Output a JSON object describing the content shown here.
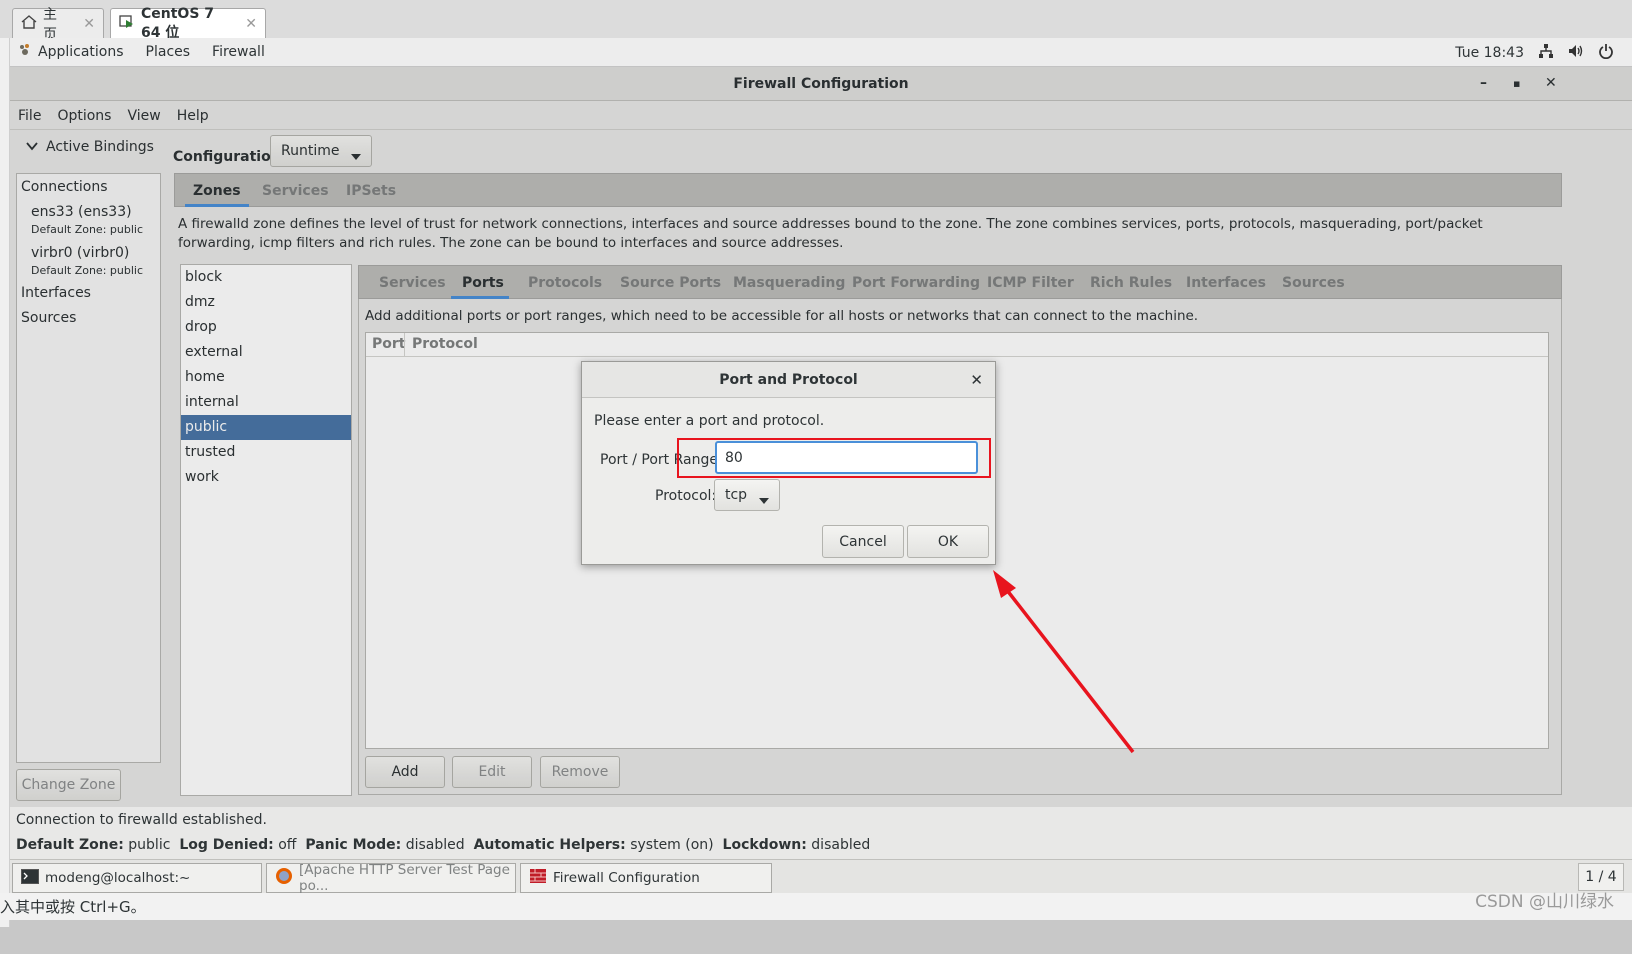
{
  "vm_tabs": [
    {
      "label": "主页",
      "icon": "home-icon"
    },
    {
      "label": "CentOS 7 64 位",
      "icon": "vm-icon"
    }
  ],
  "topbar": {
    "menus": [
      "Applications",
      "Places",
      "Firewall"
    ],
    "clock": "Tue 18:43"
  },
  "window": {
    "title": "Firewall Configuration",
    "menus": [
      "File",
      "Options",
      "View",
      "Help"
    ]
  },
  "left_panel": {
    "toggle_label": "Active Bindings",
    "connections_label": "Connections",
    "connections": [
      {
        "name": "ens33 (ens33)",
        "zone": "Default Zone: public"
      },
      {
        "name": "virbr0 (virbr0)",
        "zone": "Default Zone: public"
      }
    ],
    "interfaces_label": "Interfaces",
    "sources_label": "Sources",
    "change_zone": "Change Zone"
  },
  "config": {
    "label": "Configuration:",
    "value": "Runtime"
  },
  "zones_tabs": [
    "Zones",
    "Services",
    "IPSets"
  ],
  "zone_description": "A firewalld zone defines the level of trust for network connections, interfaces and source addresses bound to the zone. The zone combines services, ports, protocols, masquerading, port/packet forwarding, icmp filters and rich rules. The zone can be bound to interfaces and source addresses.",
  "zones": [
    "block",
    "dmz",
    "drop",
    "external",
    "home",
    "internal",
    "public",
    "trusted",
    "work"
  ],
  "inner_tabs": [
    "Services",
    "Ports",
    "Protocols",
    "Source Ports",
    "Masquerading",
    "Port Forwarding",
    "ICMP Filter",
    "Rich Rules",
    "Interfaces",
    "Sources"
  ],
  "ports": {
    "description": "Add additional ports or port ranges, which need to be accessible for all hosts or networks that can connect to the machine.",
    "col_port": "Port",
    "col_protocol": "Protocol",
    "add": "Add",
    "edit": "Edit",
    "remove": "Remove"
  },
  "status": {
    "line1": "Connection to firewalld established.",
    "default_zone_label": "Default Zone:",
    "default_zone": "public",
    "log_denied_label": "Log Denied:",
    "log_denied": "off",
    "panic_label": "Panic Mode:",
    "panic": "disabled",
    "helpers_label": "Automatic Helpers:",
    "helpers": "system (on)",
    "lockdown_label": "Lockdown:",
    "lockdown": "disabled"
  },
  "dialog": {
    "title": "Port and Protocol",
    "prompt": "Please enter a port and protocol.",
    "port_label": "Port / Port Range:",
    "port_value": "80",
    "protocol_label": "Protocol:",
    "protocol_value": "tcp",
    "cancel": "Cancel",
    "ok": "OK"
  },
  "taskbar": {
    "items": [
      "modeng@localhost:~",
      "[Apache HTTP Server Test Page po...",
      "Firewall Configuration"
    ],
    "pager": "1 / 4"
  },
  "host_bottom": "入其中或按 Ctrl+G。",
  "watermark": "CSDN @山川绿水",
  "colors": {
    "selection": "#4a76a8",
    "focus": "#4a90d9",
    "annotation": "#e8141e"
  }
}
